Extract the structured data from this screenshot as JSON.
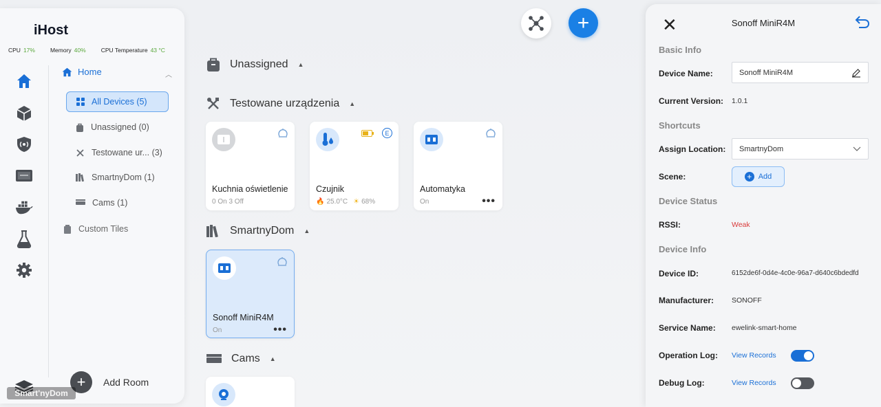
{
  "app": {
    "title": "iHost",
    "stats": [
      {
        "label": "CPU",
        "value": "17%"
      },
      {
        "label": "Memory",
        "value": "40%"
      },
      {
        "label": "CPU Temperature",
        "value": "43 °C"
      }
    ]
  },
  "rail_icons": [
    "home-icon",
    "cube-icon",
    "shield-icon",
    "monitor-icon",
    "docker-icon",
    "flask-icon",
    "gear-icon"
  ],
  "tree": {
    "home_label": "Home",
    "items": [
      {
        "label": "All Devices",
        "count": "(5)"
      },
      {
        "label": "Unassigned",
        "count": "(0)"
      },
      {
        "label": "Testowane ur...",
        "count": "(3)"
      },
      {
        "label": "SmartnyDom",
        "count": "(1)"
      },
      {
        "label": "Cams",
        "count": "(1)"
      }
    ],
    "custom_tiles": "Custom Tiles",
    "add_room": "Add Room"
  },
  "watermark": "Smart'nyDom",
  "groups": {
    "unassigned": "Unassigned",
    "testowane": "Testowane urządzenia",
    "smartnydom": "SmartnyDom",
    "cams": "Cams"
  },
  "cards": {
    "kuchnia": {
      "name": "Kuchnia oświetlenie",
      "sub": "0 On 3 Off"
    },
    "czujnik": {
      "name": "Czujnik",
      "temp": "25.0°C",
      "humidity": "68%",
      "badge": "E"
    },
    "automatyka": {
      "name": "Automatyka",
      "sub": "On"
    },
    "sonoff": {
      "name": "Sonoff MiniR4M",
      "sub": "On"
    }
  },
  "panel": {
    "title": "Sonoff MiniR4M",
    "sections": {
      "basic": "Basic Info",
      "shortcuts": "Shortcuts",
      "status": "Device Status",
      "info": "Device Info"
    },
    "labels": {
      "device_name": "Device Name:",
      "current_version": "Current Version:",
      "assign_location": "Assign Location:",
      "scene": "Scene:",
      "rssi": "RSSI:",
      "device_id": "Device ID:",
      "manufacturer": "Manufacturer:",
      "service_name": "Service Name:",
      "operation_log": "Operation Log:",
      "debug_log": "Debug Log:"
    },
    "values": {
      "device_name": "Sonoff MiniR4M",
      "current_version": "1.0.1",
      "assign_location": "SmartnyDom",
      "scene_button": "Add",
      "rssi": "Weak",
      "device_id": "6152de6f-0d4e-4c0e-96a7-d640c6bdedfd",
      "manufacturer": "SONOFF",
      "service_name": "ewelink-smart-home",
      "view_records": "View Records",
      "operation_log_enabled": true,
      "debug_log_enabled": false
    },
    "colors": {
      "accent": "#1a6fd6",
      "weak": "#d93a3a"
    }
  }
}
